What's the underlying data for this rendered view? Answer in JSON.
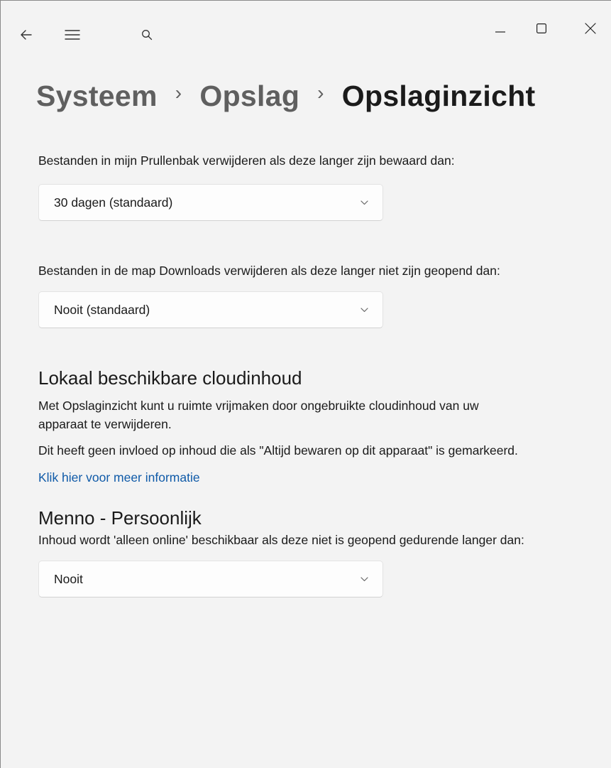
{
  "titlebar": {
    "back_icon": "back-arrow-icon",
    "menu_icon": "hamburger-menu-icon",
    "search_icon": "search-icon",
    "minimize_icon": "minimize-icon",
    "maximize_icon": "maximize-icon",
    "close_icon": "close-icon"
  },
  "breadcrumb": {
    "items": [
      "Systeem",
      "Opslag"
    ],
    "current": "Opslaginzicht",
    "separator": "›"
  },
  "recycle_bin": {
    "description": "Bestanden in mijn Prullenbak verwijderen als deze langer zijn bewaard dan:",
    "selected": "30 dagen (standaard)"
  },
  "downloads": {
    "description": "Bestanden in de map Downloads verwijderen als deze langer niet zijn geopend dan:",
    "selected": "Nooit (standaard)"
  },
  "cloud": {
    "heading": "Lokaal beschikbare cloudinhoud",
    "paragraph1": "Met Opslaginzicht kunt u ruimte vrijmaken door ongebruikte cloudinhoud van uw apparaat te verwijderen.",
    "paragraph2": "Dit heeft geen invloed op inhoud die als \"Altijd bewaren op dit apparaat\" is gemarkeerd.",
    "link": "Klik hier voor meer informatie"
  },
  "account": {
    "heading": "Menno - Persoonlijk",
    "description": "Inhoud wordt 'alleen online' beschikbaar als deze niet is geopend gedurende langer dan:",
    "selected": "Nooit"
  },
  "colors": {
    "background": "#f3f3f3",
    "link": "#0f5aa8",
    "dropdown_bg": "#fdfdfd"
  }
}
